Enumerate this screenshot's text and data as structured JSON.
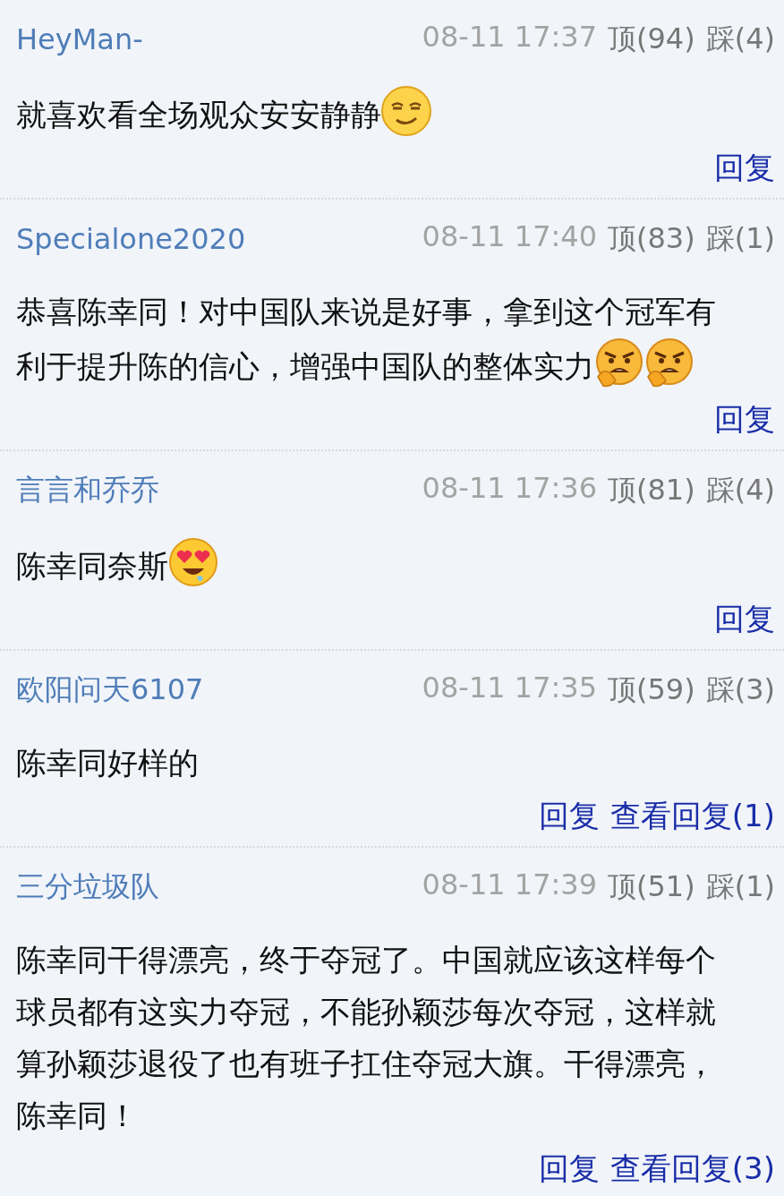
{
  "comments": [
    {
      "user": "HeyMan-",
      "time": "08-11 17:37",
      "up": "顶(94)",
      "down": "踩(4)",
      "lines": [
        "就喜欢看全场观众安安静静"
      ],
      "emojis": [
        {
          "kind": "smug"
        }
      ],
      "links": [
        "回复"
      ]
    },
    {
      "user": "Specialone2020",
      "time": "08-11 17:40",
      "up": "顶(83)",
      "down": "踩(1)",
      "lines": [
        "恭喜陈幸同！对中国队来说是好事，拿到这个冠军有",
        "利于提升陈的信心，增强中国队的整体实力"
      ],
      "emojis": [
        {
          "kind": "angry"
        },
        {
          "kind": "angry"
        }
      ],
      "links": [
        "回复"
      ]
    },
    {
      "user": "言言和乔乔",
      "time": "08-11 17:36",
      "up": "顶(81)",
      "down": "踩(4)",
      "lines": [
        "陈幸同奈斯"
      ],
      "emojis": [
        {
          "kind": "hearteyes"
        }
      ],
      "links": [
        "回复"
      ]
    },
    {
      "user": "欧阳问天6107",
      "time": "08-11 17:35",
      "up": "顶(59)",
      "down": "踩(3)",
      "lines": [
        "陈幸同好样的"
      ],
      "links": [
        "回复",
        "查看回复(1)"
      ]
    },
    {
      "user": "三分垃圾队",
      "time": "08-11 17:39",
      "up": "顶(51)",
      "down": "踩(1)",
      "lines": [
        "陈幸同干得漂亮，终于夺冠了。中国就应该这样每个",
        "球员都有这实力夺冠，不能孙颖莎每次夺冠，这样就",
        "算孙颖莎退役了也有班子扛住夺冠大旗。干得漂亮，",
        "陈幸同！"
      ],
      "links": [
        "回复",
        "查看回复(3)"
      ]
    }
  ]
}
